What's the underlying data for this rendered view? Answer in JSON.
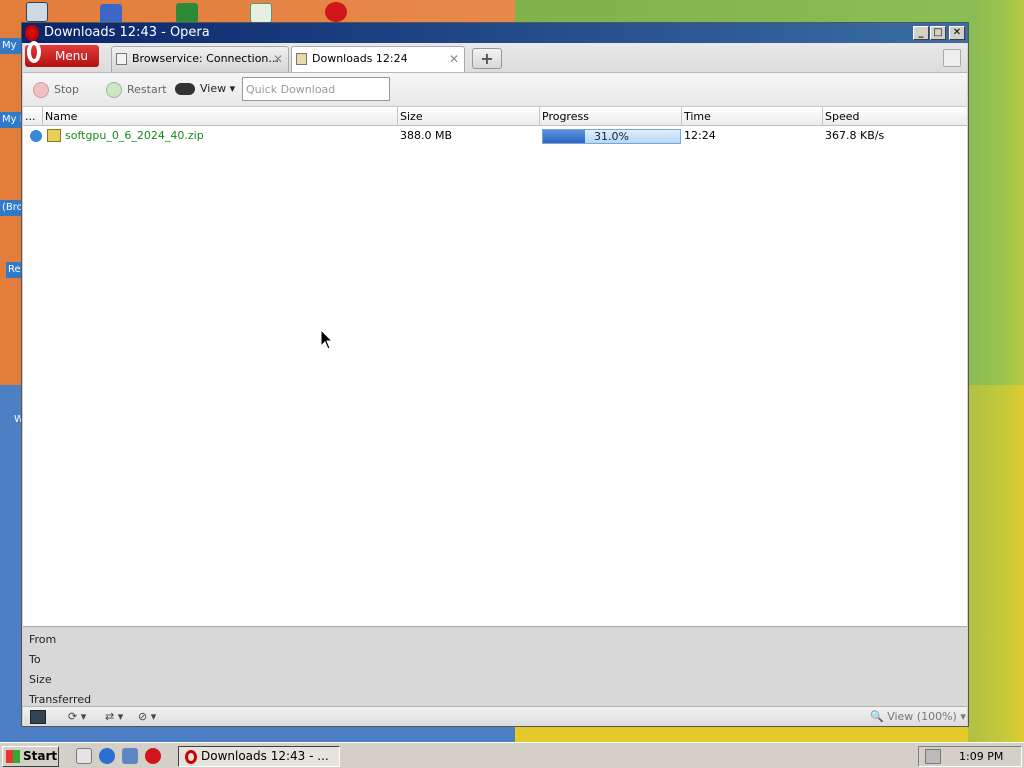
{
  "desktop": {
    "labels": [
      "My",
      "My I",
      "(Bro",
      "Re",
      "W"
    ]
  },
  "window": {
    "title": "Downloads 12:43 - Opera",
    "buttons": {
      "minimize": "_",
      "maximize": "□",
      "close": "✕"
    }
  },
  "tabbar": {
    "menu_label": "Menu",
    "tabs": [
      {
        "label": "Browservice: Connection...",
        "close": "✕"
      },
      {
        "label": "Downloads 12:24",
        "close": "✕"
      }
    ],
    "new_tab": "+"
  },
  "toolbar": {
    "stop": "Stop",
    "restart": "Restart",
    "view": "View",
    "quick_download_placeholder": "Quick Download"
  },
  "list": {
    "columns": [
      "...",
      "Name",
      "Size",
      "Progress",
      "Time",
      "Speed"
    ],
    "rows": [
      {
        "name": "softgpu_0_6_2024_40.zip",
        "size": "388.0 MB",
        "progress": 0.31,
        "progress_label": "31.0%",
        "time": "12:24",
        "speed": "367.8 KB/s"
      }
    ]
  },
  "details": {
    "from": "From",
    "to": "To",
    "size": "Size",
    "transferred": "Transferred"
  },
  "statusbar": {
    "zoom": "View (100%)"
  },
  "taskbar": {
    "start": "Start",
    "task": "Downloads 12:43 - ...",
    "clock": "1:09 PM"
  },
  "colors": {
    "accent": "#0a246a",
    "opera_red": "#cc0f16",
    "progress": "#2d67c0",
    "file_name": "#1a8a1a"
  }
}
